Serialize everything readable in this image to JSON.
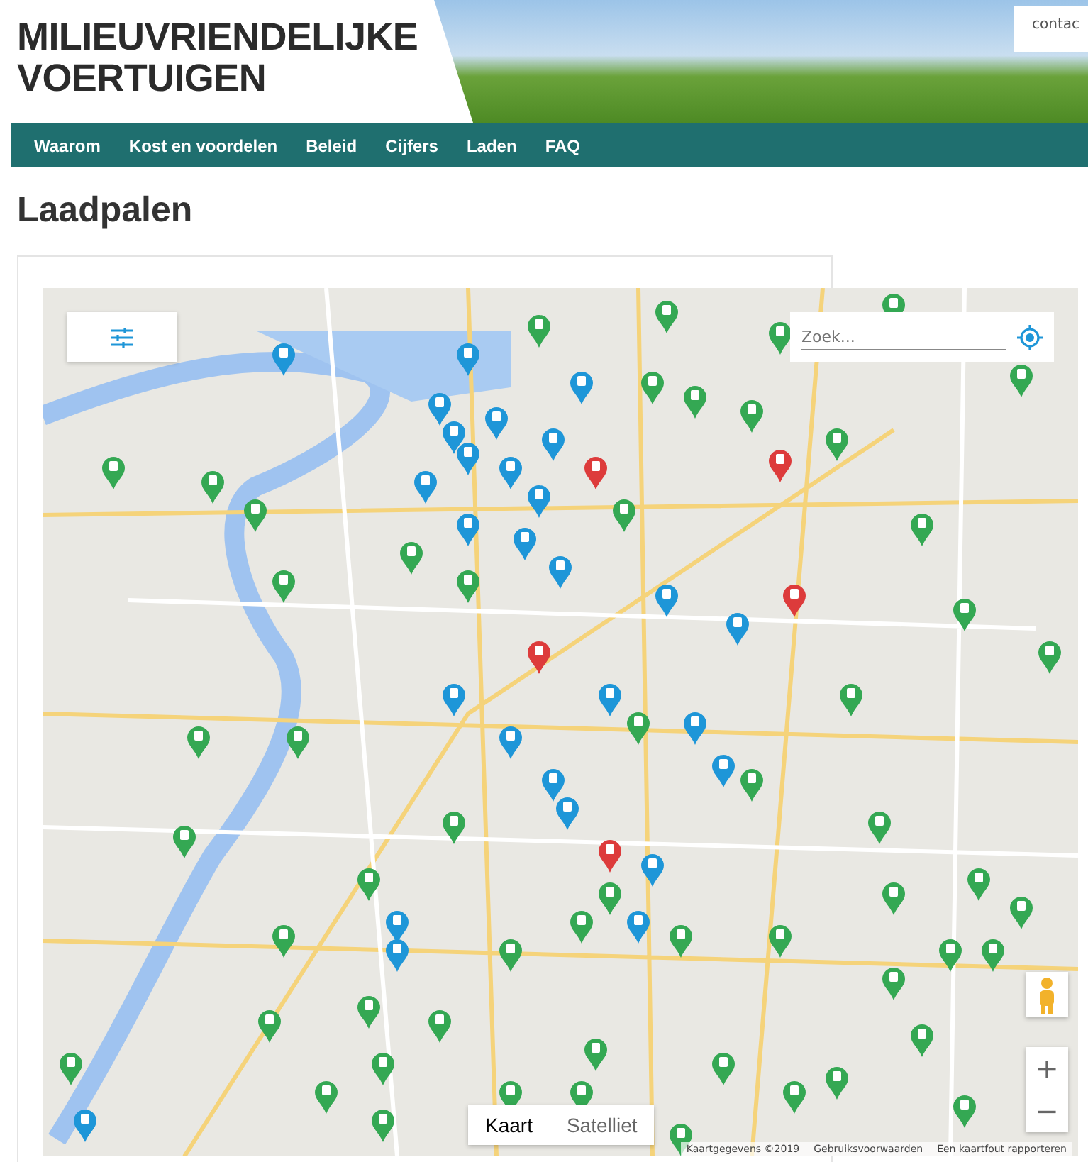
{
  "site": {
    "title_lines": [
      "MILIEUVRIENDELIJKE",
      "VOERTUIGEN"
    ],
    "contact": "contac"
  },
  "nav": [
    "Waarom",
    "Kost en voordelen",
    "Beleid",
    "Cijfers",
    "Laden",
    "FAQ"
  ],
  "page": {
    "title": "Laadpalen"
  },
  "map": {
    "search": {
      "placeholder": "Zoek..."
    },
    "map_types": [
      {
        "label": "Kaart",
        "selected": true
      },
      {
        "label": "Satelliet",
        "selected": false
      }
    ],
    "zoom": [
      "+",
      "−"
    ],
    "footer": [
      "Kaartgegevens ©2019",
      "Gebruiksvoorwaarden",
      "Een kaartfout rapporteren"
    ]
  }
}
